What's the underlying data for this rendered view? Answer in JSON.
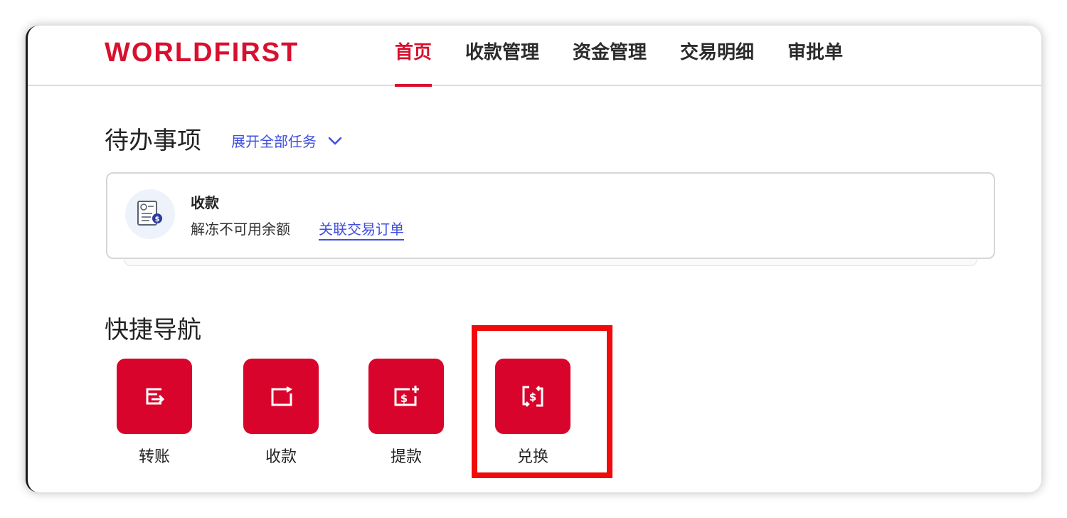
{
  "header": {
    "logo": "WORLDFIRST",
    "nav": [
      {
        "label": "首页",
        "active": true
      },
      {
        "label": "收款管理",
        "active": false
      },
      {
        "label": "资金管理",
        "active": false
      },
      {
        "label": "交易明细",
        "active": false
      },
      {
        "label": "审批单",
        "active": false
      }
    ]
  },
  "todo": {
    "title": "待办事项",
    "expand_label": "展开全部任务",
    "task": {
      "title": "收款",
      "description": "解冻不可用余额",
      "link": "关联交易订单"
    }
  },
  "quick_nav": {
    "title": "快捷导航",
    "items": [
      {
        "label": "转账",
        "icon": "transfer-icon"
      },
      {
        "label": "收款",
        "icon": "receive-icon"
      },
      {
        "label": "提款",
        "icon": "withdraw-icon"
      },
      {
        "label": "兑换",
        "icon": "exchange-icon"
      }
    ]
  },
  "colors": {
    "brand": "#d8102e",
    "link": "#3f4fe0",
    "highlight": "#f00a0a"
  }
}
